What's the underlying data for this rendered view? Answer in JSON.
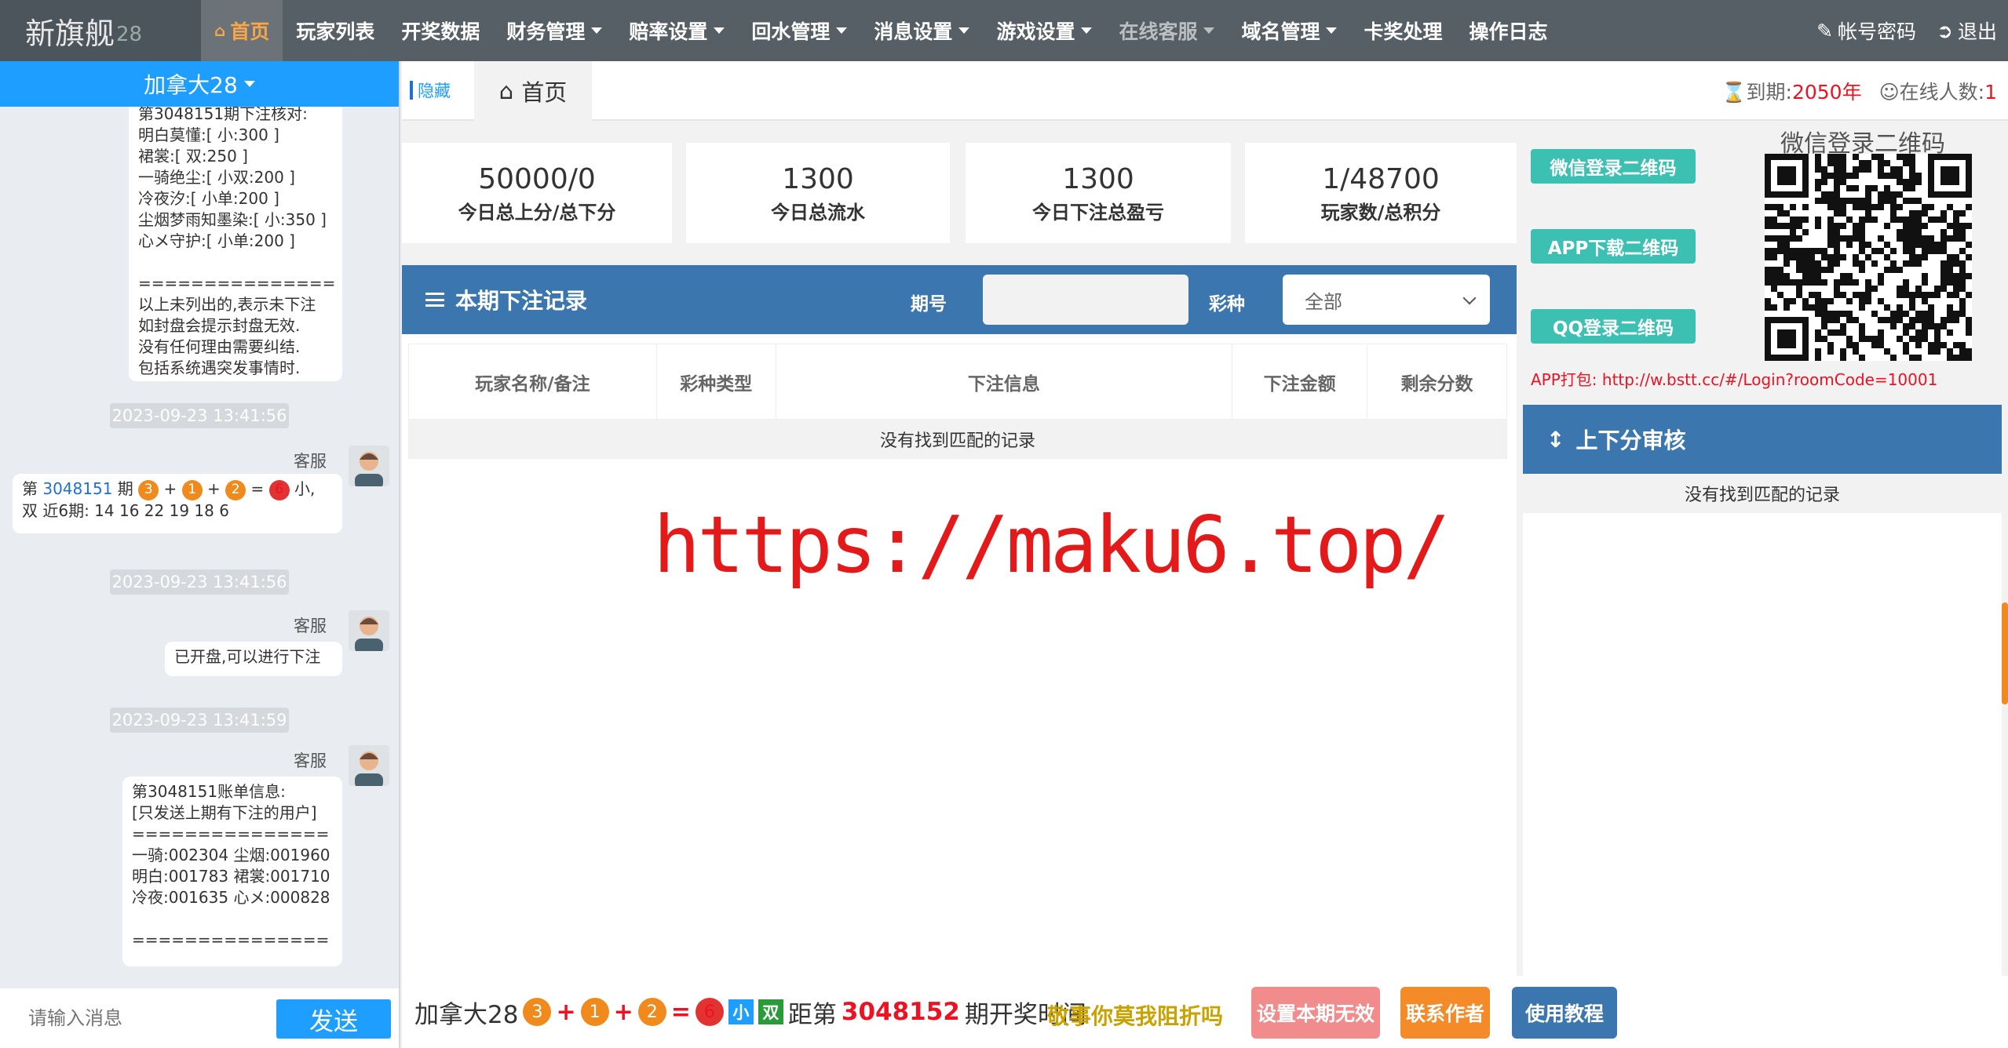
{
  "brand": {
    "name": "新旗舰",
    "suffix": "28"
  },
  "nav": [
    {
      "label": "首页",
      "active": true,
      "icon": "home-icon"
    },
    {
      "label": "玩家列表"
    },
    {
      "label": "开奖数据"
    },
    {
      "label": "财务管理",
      "dropdown": true
    },
    {
      "label": "赔率设置",
      "dropdown": true
    },
    {
      "label": "回水管理",
      "dropdown": true
    },
    {
      "label": "消息设置",
      "dropdown": true
    },
    {
      "label": "游戏设置",
      "dropdown": true
    },
    {
      "label": "在线客服",
      "dropdown": true,
      "dim": true
    },
    {
      "label": "域名管理",
      "dropdown": true
    },
    {
      "label": "卡奖处理"
    },
    {
      "label": "操作日志"
    }
  ],
  "topright": {
    "account": "帐号密码",
    "logout": "退出"
  },
  "left": {
    "region": "加拿大28",
    "msg1": "第3048151期下注核对:\n明白莫懂:[ 小:300 ]\n裙裳:[ 双:250 ]\n一骑绝尘:[ 小双:200 ]\n冷夜汐:[ 小单:200 ]\n尘烟梦雨知墨染:[ 小:350 ]\n心メ守护:[ 小单:200 ]\n\n===============\n以上未列出的,表示未下注\n如封盘会提示封盘无效.\n没有任何理由需要纠结.\n包括系统遇突发事情时.",
    "ts1": "2023-09-23 13:41:56",
    "who": "客服",
    "msg2": {
      "pre": "第 ",
      "issue": "3048151",
      "mid": " 期",
      "b1": "3",
      "plus": "+",
      "b2": "1",
      "b3": "2",
      "eq": "=",
      "b4": "6",
      "res": " 小,",
      "line2": "双 近6期: 14 16 22 19 18 6"
    },
    "ts2": "2023-09-23 13:41:56",
    "msg3": "已开盘,可以进行下注",
    "ts3": "2023-09-23 13:41:59",
    "msg4": "第3048151账单信息:\n[只发送上期有下注的用户]\n===============\n一骑:002304 尘烟:001960\n明白:001783 裙裳:001710\n冷夜:001635 心メ:000828\n\n===============",
    "input_placeholder": "请输入消息",
    "send": "发送"
  },
  "tabbar": {
    "hide": "隐藏",
    "home": "首页",
    "expire_label": "到期:",
    "expire_value": "2050年",
    "online_label": "在线人数:",
    "online_value": "1"
  },
  "stats": [
    {
      "num": "50000/0",
      "label": "今日总上分/总下分"
    },
    {
      "num": "1300",
      "label": "今日总流水"
    },
    {
      "num": "1300",
      "label": "今日下注总盈亏"
    },
    {
      "num": "1/48700",
      "label": "玩家数/总积分"
    }
  ],
  "bets": {
    "title": "本期下注记录",
    "issue_label": "期号",
    "kind_label": "彩种",
    "kind_value": "全部",
    "columns": [
      "玩家名称/备注",
      "彩种类型",
      "下注信息",
      "下注金额",
      "剩余分数"
    ],
    "empty": "没有找到匹配的记录"
  },
  "watermark": "https://maku6.top/",
  "right": {
    "btn_wechat": "微信登录二维码",
    "btn_app": "APP下载二维码",
    "btn_qq": "QQ登录二维码",
    "qr_title": "微信登录二维码",
    "app_pack": "APP打包: http://w.bstt.cc/#/Login?roomCode=10001",
    "audit_title": "上下分审核",
    "audit_empty": "没有找到匹配的记录"
  },
  "bottom": {
    "game": "加拿大28",
    "b1": "3",
    "b2": "1",
    "b3": "2",
    "b4": "6",
    "plus": "+",
    "eq": "=",
    "size": "小",
    "parity": "双",
    "t1": "距第",
    "next_issue": "3048152",
    "t2": "期开奖时间",
    "ticker": "敬事你莫我阻折吗",
    "btn_invalid": "设置本期无效",
    "btn_contact": "联系作者",
    "btn_tutorial": "使用教程"
  },
  "colors": {
    "accent": "#1e9fff",
    "panel_blue": "#3b77ae",
    "teal": "#3cc0b1",
    "nav_bg": "#565f66"
  }
}
